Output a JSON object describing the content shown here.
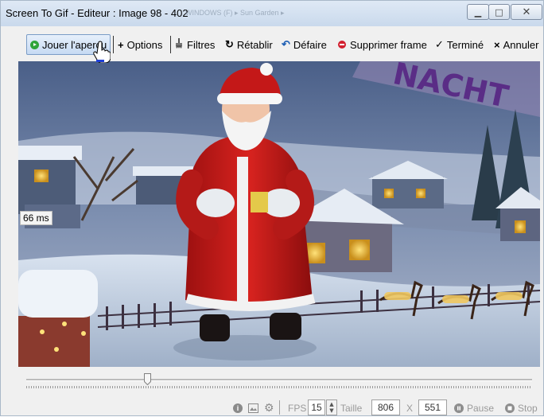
{
  "window": {
    "title": "Screen To Gif - Editeur : Image 98 - 402",
    "ghost_text": "WINDOWS (F) ▸ Sun Garden ▸",
    "minimize_glyph": "▁",
    "maximize_glyph": "□",
    "close_glyph": "✕"
  },
  "toolbar": {
    "play": "Jouer l'aperçu",
    "options": "Options",
    "filters": "Filtres",
    "restore": "Rétablir",
    "undo": "Défaire",
    "delete_frame": "Supprimer frame",
    "done": "Terminé",
    "cancel": "Annuler",
    "options_icon": "+",
    "done_icon": "✓",
    "cancel_icon": "×",
    "undo_icon": "↶",
    "restore_icon": "↻"
  },
  "frame": {
    "delay_label": "66 ms",
    "banner_text": "NACHT"
  },
  "timeline": {
    "position_fraction": 0.24
  },
  "status": {
    "fps_label": "FPS",
    "fps_value": "15",
    "size_label": "Taille",
    "width_value": "806",
    "x_label": "X",
    "height_value": "551",
    "pause_label": "Pause",
    "stop_label": "Stop",
    "info_glyph": "i"
  },
  "colors": {
    "accent_green": "#2ea43a",
    "accent_red": "#d2202f",
    "titlebar": "#c9d9ec"
  }
}
